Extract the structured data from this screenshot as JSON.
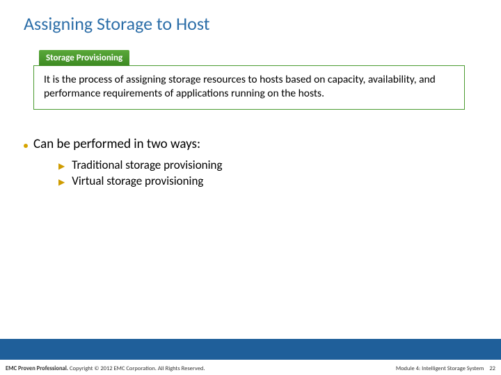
{
  "title": "Assigning Storage to Host",
  "definition": {
    "tab": "Storage Provisioning",
    "text": "It is the process of assigning storage resources to hosts based on capacity, availability, and performance requirements of applications running on the hosts."
  },
  "bullet": "Can be performed in two ways:",
  "subbullets": [
    "Traditional storage provisioning",
    "Virtual storage provisioning"
  ],
  "footer": {
    "brand": "EMC Proven Professional.",
    "copyright": " Copyright © 2012 EMC Corporation. All Rights Reserved.",
    "module": "Module 4: Intelligent Storage System",
    "page": "22"
  }
}
